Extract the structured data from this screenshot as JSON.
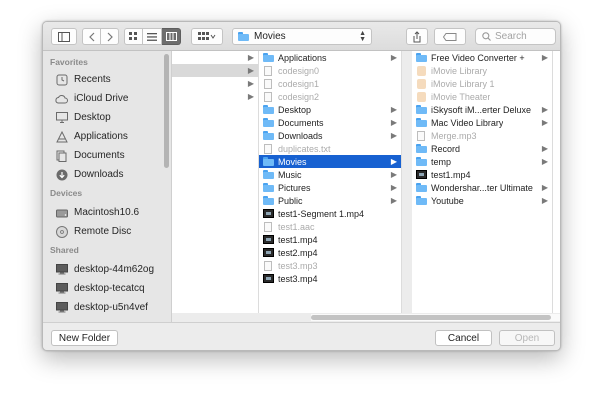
{
  "toolbar": {
    "path_label": "Movies",
    "search_placeholder": "Search"
  },
  "sidebar": {
    "favorites_header": "Favorites",
    "favorites": [
      {
        "label": "Recents",
        "icon": "clock-icon"
      },
      {
        "label": "iCloud Drive",
        "icon": "cloud-icon"
      },
      {
        "label": "Desktop",
        "icon": "desktop-icon"
      },
      {
        "label": "Applications",
        "icon": "applications-icon"
      },
      {
        "label": "Documents",
        "icon": "documents-icon"
      },
      {
        "label": "Downloads",
        "icon": "downloads-icon"
      }
    ],
    "devices_header": "Devices",
    "devices": [
      {
        "label": "Macintosh10.6",
        "icon": "hard-drive-icon"
      },
      {
        "label": "Remote Disc",
        "icon": "disc-icon"
      }
    ],
    "shared_header": "Shared",
    "shared": [
      {
        "label": "desktop-44m62og",
        "icon": "network-computer-icon"
      },
      {
        "label": "desktop-tecatcq",
        "icon": "network-computer-icon"
      },
      {
        "label": "desktop-u5n4vef",
        "icon": "network-computer-icon"
      }
    ]
  },
  "columns": {
    "home": [
      {
        "name": "Applications",
        "kind": "folder",
        "chevron": true
      },
      {
        "name": "codesign0",
        "kind": "doc",
        "dim": true
      },
      {
        "name": "codesign1",
        "kind": "doc",
        "dim": true
      },
      {
        "name": "codesign2",
        "kind": "doc",
        "dim": true
      },
      {
        "name": "Desktop",
        "kind": "folder",
        "chevron": true
      },
      {
        "name": "Documents",
        "kind": "folder",
        "chevron": true
      },
      {
        "name": "Downloads",
        "kind": "folder",
        "chevron": true
      },
      {
        "name": "duplicates.txt",
        "kind": "doc",
        "dim": true
      },
      {
        "name": "Movies",
        "kind": "folder",
        "chevron": true,
        "selected": true
      },
      {
        "name": "Music",
        "kind": "folder",
        "chevron": true
      },
      {
        "name": "Pictures",
        "kind": "folder",
        "chevron": true
      },
      {
        "name": "Public",
        "kind": "folder",
        "chevron": true
      },
      {
        "name": "test1-Segment 1.mp4",
        "kind": "video"
      },
      {
        "name": "test1.aac",
        "kind": "doc",
        "dim": true
      },
      {
        "name": "test1.mp4",
        "kind": "video"
      },
      {
        "name": "test2.mp4",
        "kind": "video"
      },
      {
        "name": "test3.mp3",
        "kind": "doc",
        "dim": true
      },
      {
        "name": "test3.mp4",
        "kind": "video"
      }
    ],
    "movies": [
      {
        "name": "Free Video Converter +",
        "kind": "folder",
        "chevron": true
      },
      {
        "name": "iMovie Library",
        "kind": "imovie",
        "dim": true
      },
      {
        "name": "iMovie Library 1",
        "kind": "imovie",
        "dim": true
      },
      {
        "name": "iMovie Theater",
        "kind": "imovie",
        "dim": true
      },
      {
        "name": "iSkysoft iM...erter Deluxe",
        "kind": "folder",
        "chevron": true
      },
      {
        "name": "Mac Video Library",
        "kind": "folder",
        "chevron": true
      },
      {
        "name": "Merge.mp3",
        "kind": "doc",
        "dim": true
      },
      {
        "name": "Record",
        "kind": "folder",
        "chevron": true
      },
      {
        "name": "temp",
        "kind": "folder",
        "chevron": true
      },
      {
        "name": "test1.mp4",
        "kind": "video"
      },
      {
        "name": "Wondershar...ter Ultimate",
        "kind": "folder",
        "chevron": true
      },
      {
        "name": "Youtube",
        "kind": "folder",
        "chevron": true
      }
    ]
  },
  "bottom": {
    "new_folder": "New Folder",
    "cancel": "Cancel",
    "open": "Open"
  }
}
